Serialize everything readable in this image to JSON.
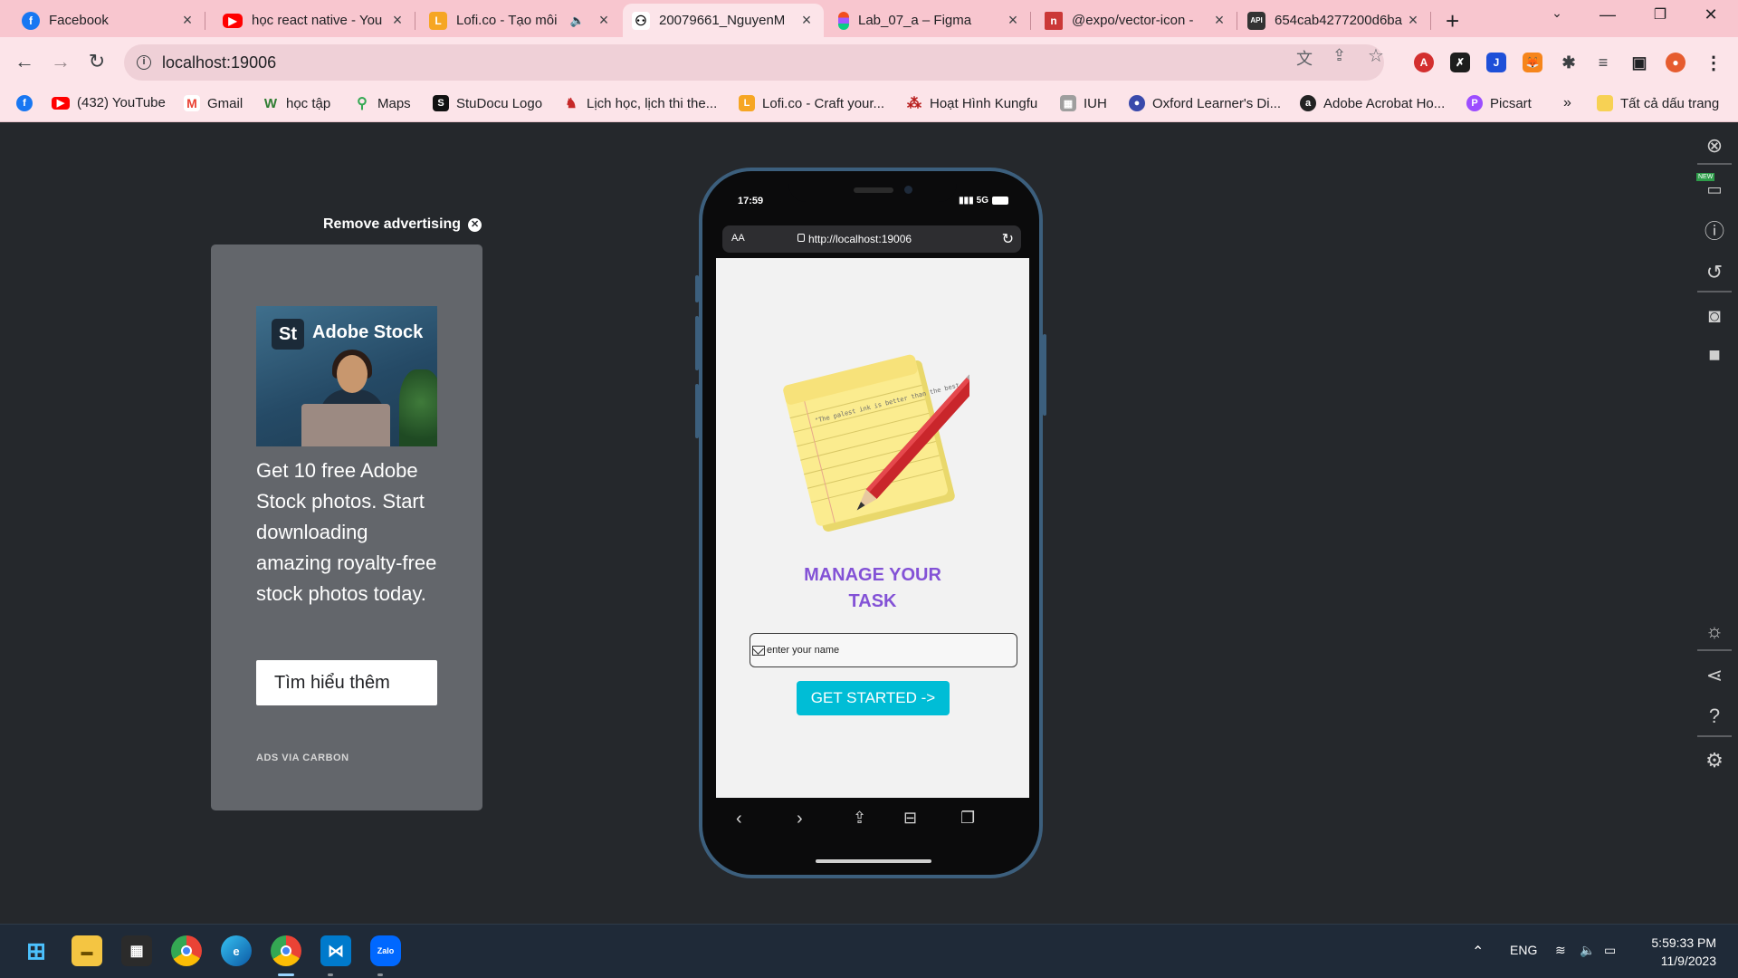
{
  "tabs": [
    {
      "title": "Facebook",
      "favicon": "facebook-icon",
      "color": "#1877f2"
    },
    {
      "title": "học react native - You",
      "favicon": "youtube-icon",
      "color": "#ff0000"
    },
    {
      "title": "Lofi.co - Tạo môi",
      "favicon": "lofi-icon",
      "color": "#f6a623"
    },
    {
      "title": "20079661_NguyenM",
      "favicon": "expo-icon",
      "color": "#000000",
      "active": true
    },
    {
      "title": "Lab_07_a – Figma",
      "favicon": "figma-icon",
      "color": "#f24e1e"
    },
    {
      "title": "@expo/vector-icon -",
      "favicon": "npm-icon",
      "color": "#cb3837"
    },
    {
      "title": "654cab4277200d6ba",
      "favicon": "api-icon",
      "color": "#333333"
    }
  ],
  "address_bar": {
    "url": "localhost:19006"
  },
  "bookmarks": [
    {
      "label": "",
      "icon": "facebook-icon",
      "color": "#1877f2"
    },
    {
      "label": "(432) YouTube",
      "icon": "youtube-icon",
      "color": "#ff0000"
    },
    {
      "label": "Gmail",
      "icon": "gmail-icon",
      "color": "#ea4335"
    },
    {
      "label": "học tập",
      "icon": "w-icon",
      "color": "#2e7d32"
    },
    {
      "label": "Maps",
      "icon": "maps-icon",
      "color": "#34a853"
    },
    {
      "label": "StuDocu Logo",
      "icon": "studocu-icon",
      "color": "#111111"
    },
    {
      "label": "Lịch học, lịch thi the...",
      "icon": "calendar-icon",
      "color": "#c62828"
    },
    {
      "label": "Lofi.co - Craft your...",
      "icon": "lofi-icon",
      "color": "#f6a623"
    },
    {
      "label": "Hoạt Hình Kungfu",
      "icon": "dots-icon",
      "color": "#b71c1c"
    },
    {
      "label": "IUH",
      "icon": "iuh-icon",
      "color": "#6d6d6d"
    },
    {
      "label": "Oxford Learner's Di...",
      "icon": "oxford-icon",
      "color": "#3949ab"
    },
    {
      "label": "Adobe Acrobat Ho...",
      "icon": "acrobat-icon",
      "color": "#222222"
    },
    {
      "label": "Picsart",
      "icon": "picsart-icon",
      "color": "#9c4dff"
    }
  ],
  "bookmarks_more": "»",
  "all_bookmarks": "Tất cả dấu trang",
  "ad": {
    "remove_label": "Remove advertising",
    "brand": "Adobe Stock",
    "brand_badge": "St",
    "text": "Get 10 free Adobe Stock photos. Start downloading amazing royalty-free stock photos today.",
    "button": "Tìm hiểu thêm",
    "footer": "ADS VIA CARBON"
  },
  "phone": {
    "time": "17:59",
    "network": "5G",
    "aa": "AA",
    "url": "http://localhost:19006",
    "title_line1": "MANAGE YOUR",
    "title_line2": "TASK",
    "name_placeholder": "enter your name",
    "start_button": "GET STARTED ->",
    "note_quote": "\"The palest ink is better than the best memory.\" - Chinese Proverb",
    "title_color": "#8352d6",
    "button_color": "#00bdd6"
  },
  "taskbar": {
    "lang": "ENG",
    "time": "5:59:33 PM",
    "date": "11/9/2023"
  },
  "rail": {
    "new_badge": "NEW"
  }
}
